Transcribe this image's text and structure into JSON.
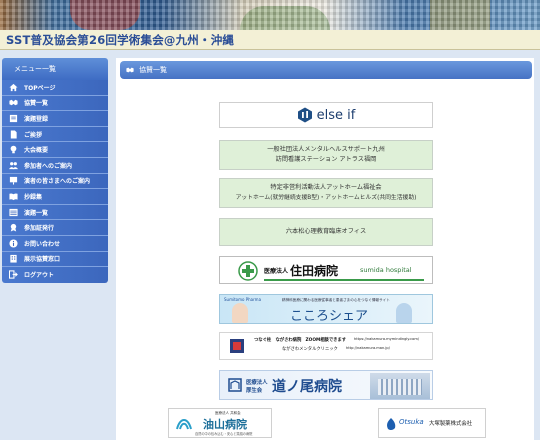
{
  "header": {
    "title": "SST普及協会第26回学術集会@九州・沖縄"
  },
  "sidebar": {
    "heading": "メニュー一覧",
    "items": [
      {
        "label": "TOPページ",
        "icon": "home-icon"
      },
      {
        "label": "協賛一覧",
        "icon": "handshake-icon"
      },
      {
        "label": "演題登録",
        "icon": "form-icon"
      },
      {
        "label": "ご挨拶",
        "icon": "document-icon"
      },
      {
        "label": "大会概要",
        "icon": "lightbulb-icon"
      },
      {
        "label": "参加者へのご案内",
        "icon": "people-icon"
      },
      {
        "label": "演者の皆さまへのご案内",
        "icon": "speaker-icon"
      },
      {
        "label": "抄録集",
        "icon": "book-icon"
      },
      {
        "label": "演題一覧",
        "icon": "list-icon"
      },
      {
        "label": "参加証発行",
        "icon": "certificate-icon"
      },
      {
        "label": "お問い合わせ",
        "icon": "info-icon"
      },
      {
        "label": "展示協賛窓口",
        "icon": "building-icon"
      },
      {
        "label": "ログアウト",
        "icon": "logout-icon"
      }
    ]
  },
  "main": {
    "section_title": "協賛一覧",
    "sponsors": {
      "elseif": "else if",
      "mhs": {
        "line1": "一般社団法人メンタルヘルスサポート九州",
        "line2": "訪問看護ステーション アトラス福岡"
      },
      "atohome": {
        "line1": "特定非営利活動法人アットホーム福祉会",
        "line2": "アットホーム(就労継続支援B型)・アットホームヒルズ(共同生活援助)"
      },
      "rokuhon": {
        "line1": "六本松心理教育臨床オフィス"
      },
      "sumida": {
        "corp": "医療法人",
        "name": "住田病院",
        "en": "sumida hospital"
      },
      "kokoro": {
        "brand": "Sumitomo Pharma",
        "sub": "精神科医療に関わる医療従事者と患者さまの心をつなぐ情報サイト",
        "name": "こころシェア"
      },
      "tsunagu": {
        "line1": "つなぐ柱　ながさわ病院　ZOOM相談できます",
        "line2": "ながさわメンタルクリニック",
        "url1": "https://nakamura.mymindingly.com/",
        "url2": "http://nakamura.man.jp/"
      },
      "michi": {
        "corp": "医療法人",
        "corp2": "厚生会",
        "name": "道ノ尾病院"
      },
      "aburayama": {
        "small": "医療法人 共和会",
        "name": "油山病院",
        "sub": "自然の中の包み込む・安心と笑顔の病院"
      },
      "otsuka": {
        "brand": "Otsuka",
        "name": "大塚製薬株式会社"
      }
    }
  },
  "colors": {
    "sidebar": "#4a79cf",
    "header_title": "#2a4d96",
    "sponsor_green": "#dff0d8",
    "page_bg": "#dce6f3"
  }
}
